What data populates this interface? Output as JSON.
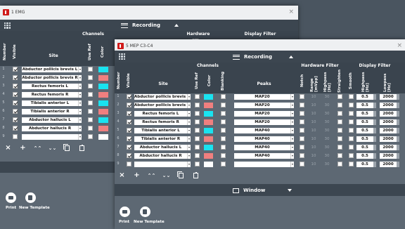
{
  "back": {
    "title": "1 EMG",
    "close": "×",
    "recording": "Recording",
    "group_channels": "Channels",
    "group_hw": "Hardware Filter",
    "group_display": "Display Filter",
    "hdr_number": "Number",
    "hdr_visible": "Visible",
    "hdr_site": "Site",
    "hdr_useref": "Use Ref",
    "hdr_color": "Color",
    "rows": [
      {
        "n": "1",
        "vis": true,
        "site": "Abductor pollicis brevis L",
        "color": "#19e3f0"
      },
      {
        "n": "2",
        "vis": true,
        "site": "Abductor pollicis brevis R",
        "color": "#f07f7f"
      },
      {
        "n": "3",
        "vis": true,
        "site": "Rectus femoris L",
        "color": "#19e3f0"
      },
      {
        "n": "4",
        "vis": true,
        "site": "Rectus femoris R",
        "color": "#f07f7f"
      },
      {
        "n": "5",
        "vis": true,
        "site": "Tibialis anterior L",
        "color": "#19e3f0"
      },
      {
        "n": "6",
        "vis": true,
        "site": "Tibialis anterior R",
        "color": "#f07f7f"
      },
      {
        "n": "7",
        "vis": true,
        "site": "Abductor hallucis L",
        "color": "#19e3f0"
      },
      {
        "n": "8",
        "vis": true,
        "site": "Abductor hallucis R",
        "color": "#f07f7f"
      },
      {
        "n": "9",
        "vis": false,
        "site": "",
        "color": "#ffffff"
      }
    ],
    "print_label": "Print",
    "template_label": "New Template"
  },
  "front": {
    "title": "5 MEP C3-C4",
    "close": "×",
    "recording": "Recording",
    "window_label": "Window",
    "group_channels": "Channels",
    "group_hw": "Hardware Filter",
    "group_display": "Display Filter",
    "hdr_number": "Number",
    "hdr_visible": "Visible",
    "hdr_site": "Site",
    "hdr_useref": "Use Ref",
    "hdr_color": "Color",
    "hdr_blanking": "Blanking",
    "hdr_peaks": "Peaks",
    "hdr_notch": "Notch",
    "hdr_range": "Range [mVpp]",
    "hdr_highpass": "Highpass [Hz]",
    "hdr_straighten": "Straighten",
    "hdr_smooth": "Smooth",
    "hdr_highpass2": "Highpass [Hz]",
    "hdr_lowpass": "Lowpass [Hz]",
    "rows": [
      {
        "n": "1",
        "vis": true,
        "site": "Abductor pollicis brevis L",
        "color": "#19e3f0",
        "peaks": "MAP20",
        "range": "10",
        "hp": "30",
        "dhp": "0.5",
        "dlp": "2000"
      },
      {
        "n": "2",
        "vis": true,
        "site": "Abductor pollicis brevis R",
        "color": "#f07f7f",
        "peaks": "MAP20",
        "range": "10",
        "hp": "30",
        "dhp": "0.5",
        "dlp": "2000"
      },
      {
        "n": "3",
        "vis": true,
        "site": "Rectus femoris L",
        "color": "#19e3f0",
        "peaks": "MAP20",
        "range": "10",
        "hp": "30",
        "dhp": "0.5",
        "dlp": "2000"
      },
      {
        "n": "4",
        "vis": true,
        "site": "Rectus femoris R",
        "color": "#f07f7f",
        "peaks": "MAP20",
        "range": "10",
        "hp": "30",
        "dhp": "0.5",
        "dlp": "2000"
      },
      {
        "n": "5",
        "vis": true,
        "site": "Tibialis anterior L",
        "color": "#19e3f0",
        "peaks": "MAP40",
        "range": "10",
        "hp": "30",
        "dhp": "0.5",
        "dlp": "2000"
      },
      {
        "n": "6",
        "vis": true,
        "site": "Tibialis anterior R",
        "color": "#f07f7f",
        "peaks": "MAP40",
        "range": "10",
        "hp": "30",
        "dhp": "0.5",
        "dlp": "2000"
      },
      {
        "n": "7",
        "vis": true,
        "site": "Abductor hallucis L",
        "color": "#19e3f0",
        "peaks": "MAP40",
        "range": "10",
        "hp": "30",
        "dhp": "0.5",
        "dlp": "2000"
      },
      {
        "n": "8",
        "vis": true,
        "site": "Abductor hallucis R",
        "color": "#f07f7f",
        "peaks": "MAP40",
        "range": "10",
        "hp": "30",
        "dhp": "0.5",
        "dlp": "2000"
      },
      {
        "n": "9",
        "vis": false,
        "site": "",
        "color": "#ffffff",
        "peaks": "",
        "range": "10",
        "hp": "30",
        "dhp": "0.5",
        "dlp": "2000"
      }
    ],
    "print_label": "Print",
    "template_label": "New Template"
  }
}
